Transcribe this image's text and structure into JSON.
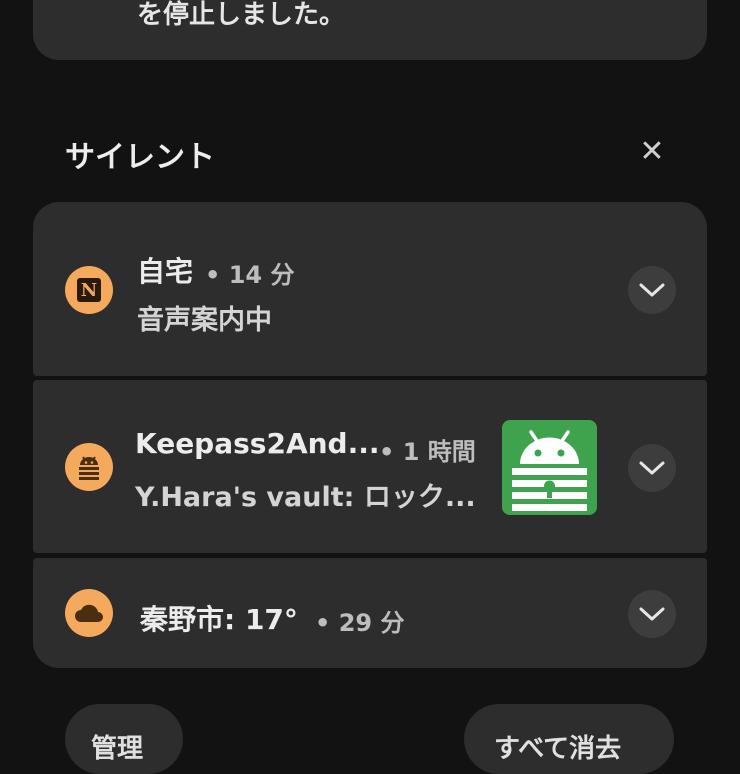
{
  "top_notification": {
    "text": "を停止しました。"
  },
  "section": {
    "title": "サイレント",
    "clear_icon": "close-icon",
    "clear_glyph": "✕"
  },
  "notifications": [
    {
      "app_icon": "notion-style-n-icon",
      "icon_letter": "N",
      "title": "自宅",
      "meta": "• 14 分",
      "body": "音声案内中"
    },
    {
      "app_icon": "keepass2android-icon",
      "title": "Keepass2And...",
      "meta": "• 1 時間",
      "body": "Y.Hara's vault: ロック...",
      "thumbnail": "keepass-android-lock-image"
    },
    {
      "app_icon": "cloud-icon",
      "title": "秦野市: 17°",
      "meta": "• 29 分"
    }
  ],
  "footer": {
    "manage_label": "管理",
    "clear_all_label": "すべて消去"
  },
  "colors": {
    "accent": "#f4a95c",
    "card": "#2d2d2d",
    "background": "#121212",
    "thumbnail_green": "#3fa34d"
  }
}
